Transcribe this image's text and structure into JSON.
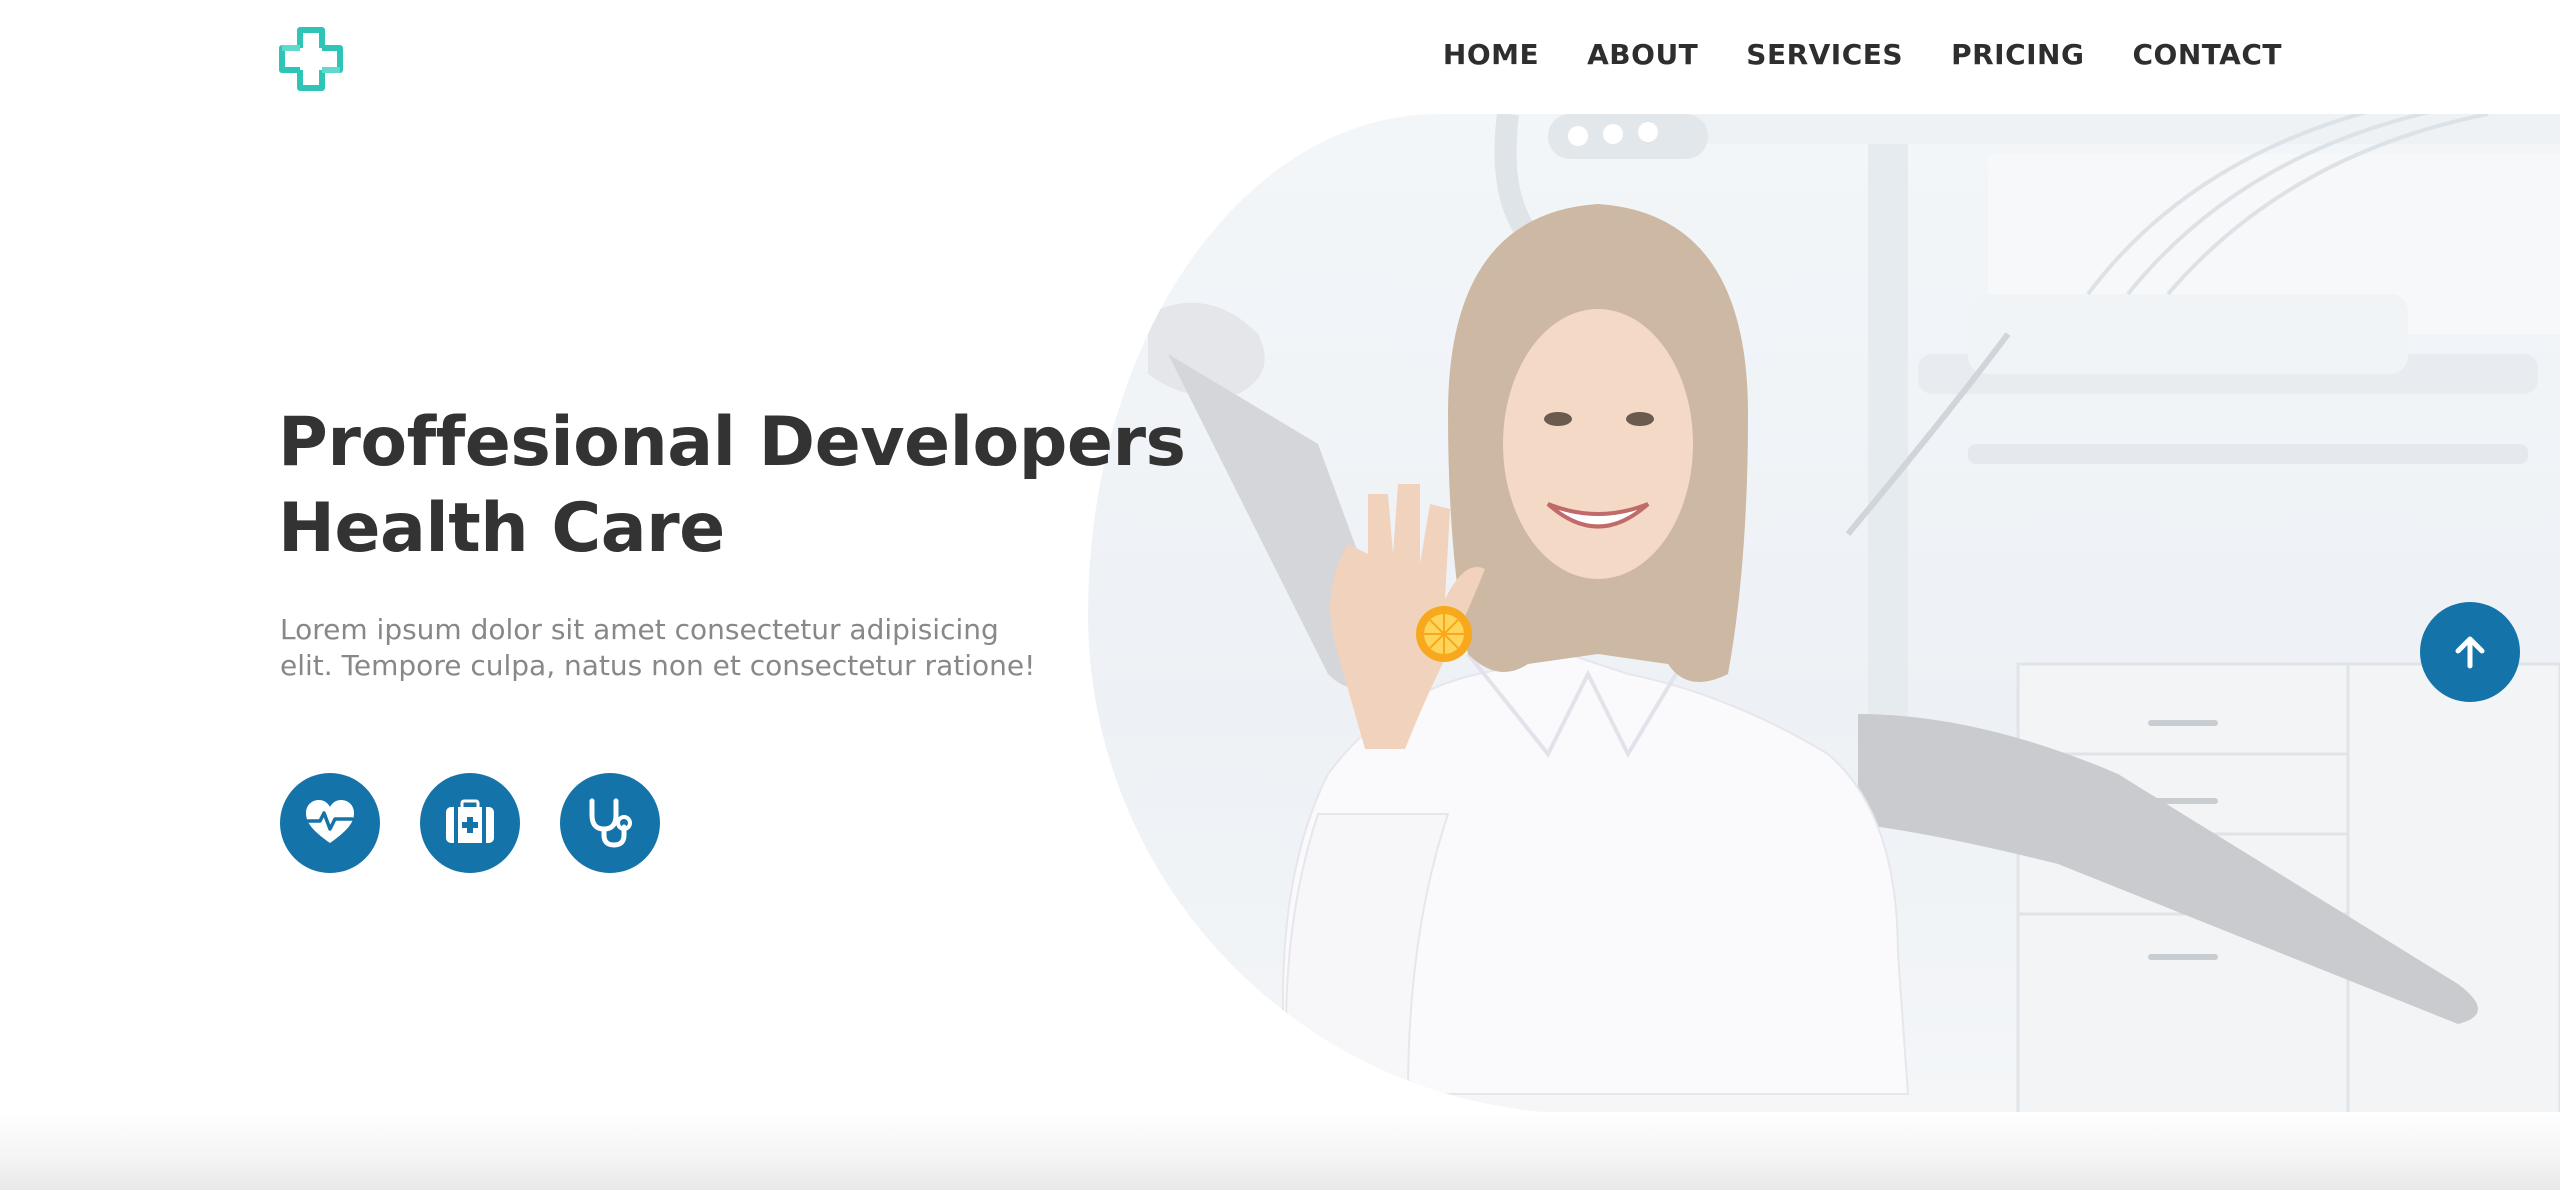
{
  "brand": {
    "logo_icon": "medical-cross-icon",
    "logo_color": "#2ec4b6"
  },
  "nav": {
    "items": [
      {
        "label": "HOME"
      },
      {
        "label": "ABOUT"
      },
      {
        "label": "SERVICES"
      },
      {
        "label": "PRICING"
      },
      {
        "label": "CONTACT"
      }
    ]
  },
  "hero": {
    "title_line1": "Proffesional Developers",
    "title_line2": "Health Care",
    "description": "Lorem ipsum dolor sit amet consectetur adipisicing elit. Tempore culpa, natus non et consectetur ratione!",
    "image_subject": "smiling-doctor-holding-orange-slice-in-dental-clinic"
  },
  "features": [
    {
      "icon": "heart-pulse-icon"
    },
    {
      "icon": "first-aid-kit-icon"
    },
    {
      "icon": "stethoscope-icon"
    }
  ],
  "scroll_top": {
    "icon": "arrow-up-icon"
  },
  "colors": {
    "primary": "#1473a8",
    "heading": "#333333",
    "body_text": "#888888",
    "nav_text": "#2e2e2e",
    "accent_teal": "#2ec4b6"
  }
}
